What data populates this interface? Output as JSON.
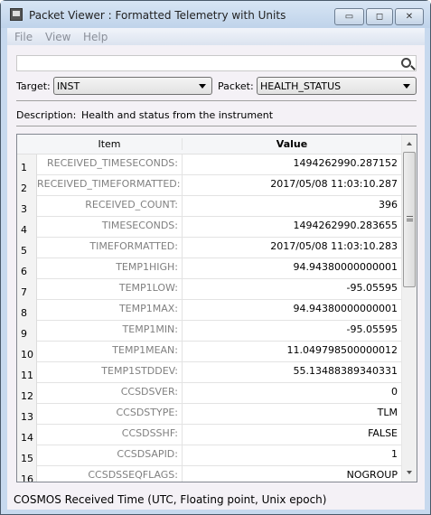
{
  "window": {
    "title": "Packet Viewer : Formatted Telemetry with Units",
    "minimize": "▭",
    "maximize": "◻",
    "close": "✕"
  },
  "menu": [
    "File",
    "View",
    "Help"
  ],
  "search": {
    "value": "",
    "placeholder": ""
  },
  "target": {
    "label": "Target:",
    "value": "INST"
  },
  "packet": {
    "label": "Packet:",
    "value": "HEALTH_STATUS"
  },
  "description": {
    "label": "Description:",
    "value": "Health and status from the instrument"
  },
  "table": {
    "headers": {
      "item": "Item",
      "value": "Value"
    },
    "rows": [
      {
        "n": "1",
        "item": "RECEIVED_TIMESECONDS:",
        "value": "1494262990.287152"
      },
      {
        "n": "2",
        "item": "RECEIVED_TIMEFORMATTED:",
        "value": "2017/05/08 11:03:10.287"
      },
      {
        "n": "3",
        "item": "RECEIVED_COUNT:",
        "value": "396"
      },
      {
        "n": "4",
        "item": "TIMESECONDS:",
        "value": "1494262990.283655"
      },
      {
        "n": "5",
        "item": "TIMEFORMATTED:",
        "value": "2017/05/08 11:03:10.283"
      },
      {
        "n": "6",
        "item": "TEMP1HIGH:",
        "value": "94.94380000000001"
      },
      {
        "n": "7",
        "item": "TEMP1LOW:",
        "value": "-95.05595"
      },
      {
        "n": "8",
        "item": "TEMP1MAX:",
        "value": "94.94380000000001"
      },
      {
        "n": "9",
        "item": "TEMP1MIN:",
        "value": "-95.05595"
      },
      {
        "n": "10",
        "item": "TEMP1MEAN:",
        "value": "11.049798500000012"
      },
      {
        "n": "11",
        "item": "TEMP1STDDEV:",
        "value": "55.13488389340331"
      },
      {
        "n": "12",
        "item": "CCSDSVER:",
        "value": "0"
      },
      {
        "n": "13",
        "item": "CCSDSTYPE:",
        "value": "TLM"
      },
      {
        "n": "14",
        "item": "CCSDSSHF:",
        "value": "FALSE"
      },
      {
        "n": "15",
        "item": "CCSDSAPID:",
        "value": "1"
      },
      {
        "n": "16",
        "item": "CCSDSSEQFLAGS:",
        "value": "NOGROUP"
      }
    ]
  },
  "status": "COSMOS Received Time (UTC, Floating point, Unix epoch)"
}
